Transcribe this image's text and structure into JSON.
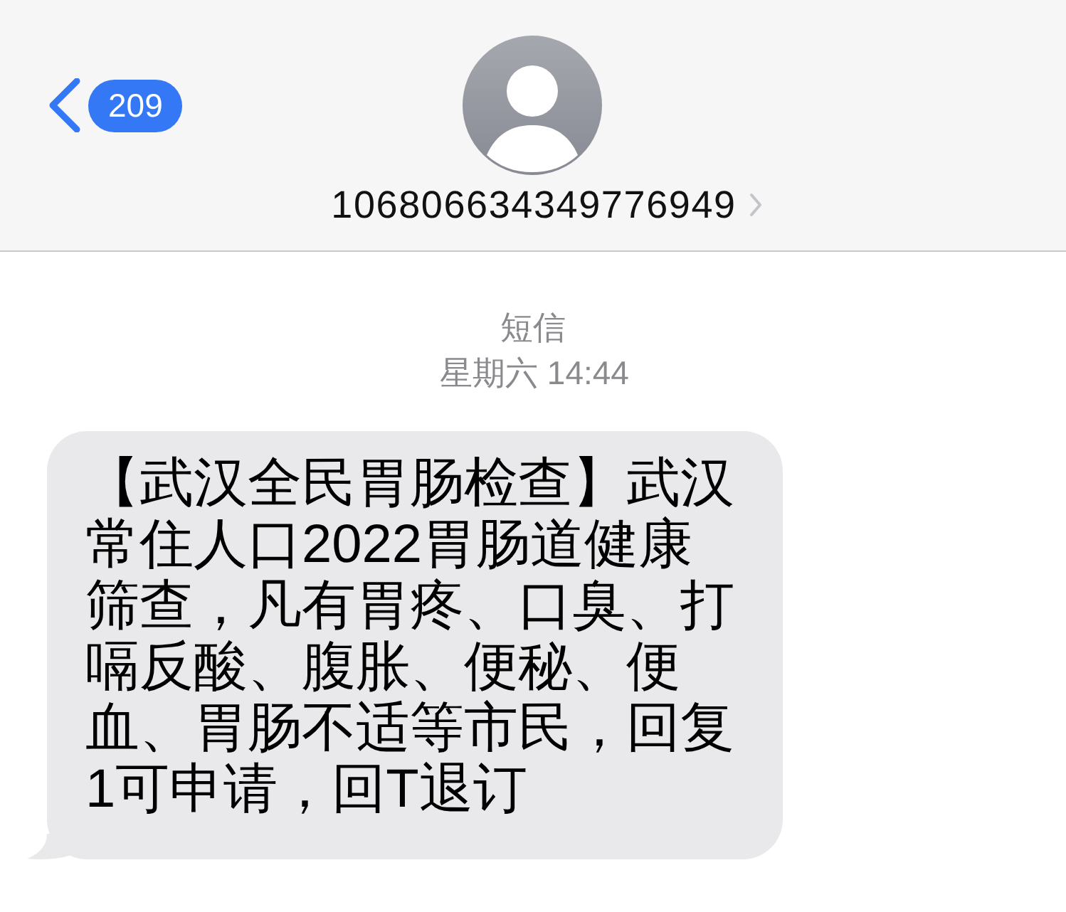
{
  "header": {
    "back_count": "209",
    "contact_number": "106806634349776949"
  },
  "thread": {
    "service_label": "短信",
    "timestamp": "星期六 14:44"
  },
  "messages": [
    {
      "kind": "incoming",
      "text": "【武汉全民胃肠检查】武汉常住人口2022胃肠道健康筛查，凡有胃疼、口臭、打嗝反酸、腹胀、便秘、便血、胃肠不适等市民，回复1可申请，回T退订"
    }
  ]
}
